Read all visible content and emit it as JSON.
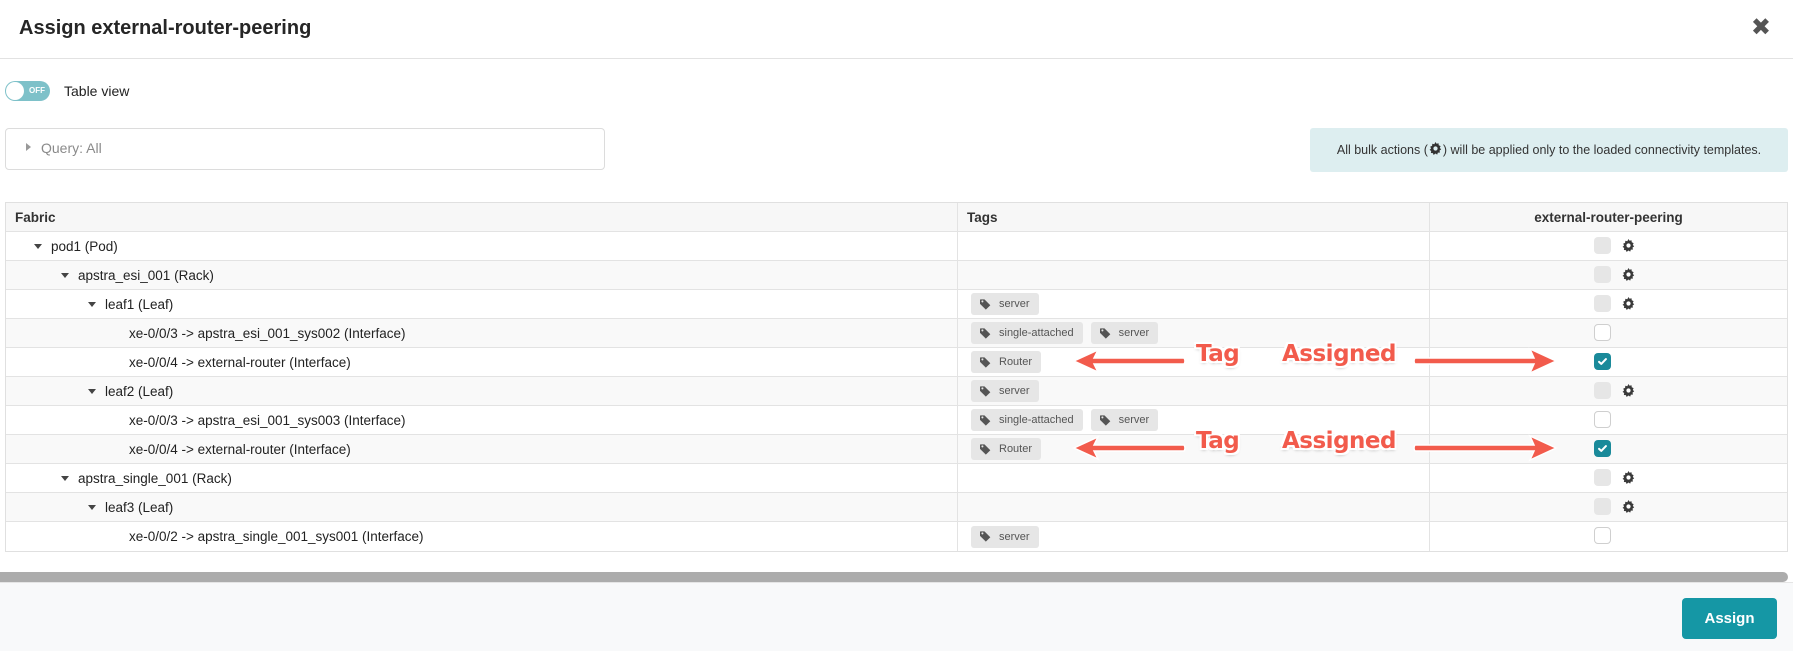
{
  "dialog": {
    "title": "Assign external-router-peering",
    "close_icon": "close-icon"
  },
  "toggle": {
    "state": "OFF",
    "label": "Table view"
  },
  "query": {
    "label": "Query: All"
  },
  "info": {
    "prefix": "All bulk actions (",
    "suffix": ") will be applied only to the loaded connectivity templates."
  },
  "table": {
    "columns": [
      "Fabric",
      "Tags",
      "external-router-peering"
    ],
    "rows": [
      {
        "label": "pod1 (Pod)",
        "level": 1,
        "expandable": true,
        "tags": [],
        "checkbox": "disabled",
        "gear": true
      },
      {
        "label": "apstra_esi_001 (Rack)",
        "level": 2,
        "expandable": true,
        "tags": [],
        "checkbox": "disabled",
        "gear": true
      },
      {
        "label": "leaf1 (Leaf)",
        "level": 3,
        "expandable": true,
        "tags": [
          "server"
        ],
        "checkbox": "disabled",
        "gear": true
      },
      {
        "label": "xe-0/0/3 -> apstra_esi_001_sys002 (Interface)",
        "level": 4,
        "expandable": false,
        "tags": [
          "single-attached",
          "server"
        ],
        "checkbox": "unchecked",
        "gear": false
      },
      {
        "label": "xe-0/0/4 -> external-router (Interface)",
        "level": 4,
        "expandable": false,
        "tags": [
          "Router"
        ],
        "checkbox": "checked",
        "gear": false
      },
      {
        "label": "leaf2 (Leaf)",
        "level": 3,
        "expandable": true,
        "tags": [
          "server"
        ],
        "checkbox": "disabled",
        "gear": true
      },
      {
        "label": "xe-0/0/3 -> apstra_esi_001_sys003 (Interface)",
        "level": 4,
        "expandable": false,
        "tags": [
          "single-attached",
          "server"
        ],
        "checkbox": "unchecked",
        "gear": false
      },
      {
        "label": "xe-0/0/4 -> external-router (Interface)",
        "level": 4,
        "expandable": false,
        "tags": [
          "Router"
        ],
        "checkbox": "checked",
        "gear": false
      },
      {
        "label": "apstra_single_001 (Rack)",
        "level": 2,
        "expandable": true,
        "tags": [],
        "checkbox": "disabled",
        "gear": true
      },
      {
        "label": "leaf3 (Leaf)",
        "level": 3,
        "expandable": true,
        "tags": [],
        "checkbox": "disabled",
        "gear": true
      },
      {
        "label": "xe-0/0/2 -> apstra_single_001_sys001 (Interface)",
        "level": 4,
        "expandable": false,
        "tags": [
          "server"
        ],
        "checkbox": "unchecked",
        "gear": false
      }
    ]
  },
  "annotations": [
    {
      "tag_label": "Tag",
      "assigned_label": "Assigned",
      "row": 4
    },
    {
      "tag_label": "Tag",
      "assigned_label": "Assigned",
      "row": 7
    }
  ],
  "footer": {
    "assign_label": "Assign"
  },
  "colors": {
    "accent": "#1597a5",
    "checkbox_checked": "#1a8a9a",
    "toggle_off": "#7ec1c9",
    "info_bg": "#ddeef0",
    "annotation": "#f25b4c"
  }
}
